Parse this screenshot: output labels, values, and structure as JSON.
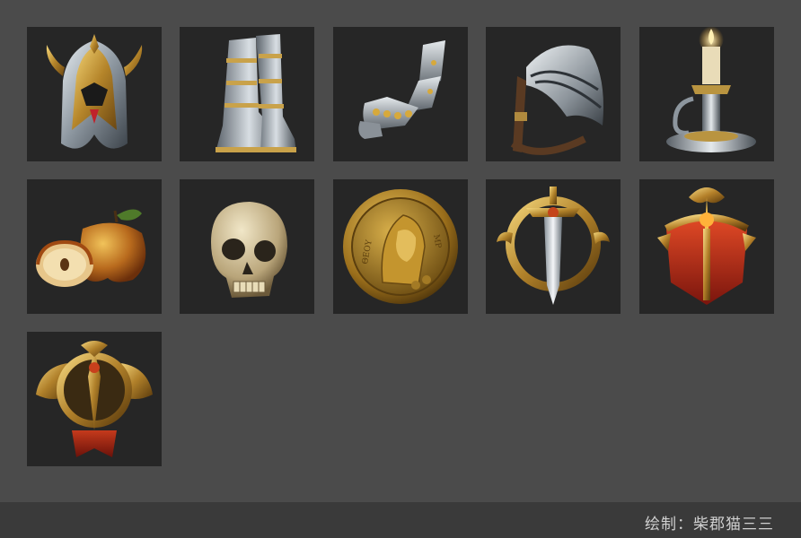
{
  "footer": {
    "credit": "绘制：柴郡猫三三"
  },
  "icons": [
    {
      "name": "golden-helmet-icon"
    },
    {
      "name": "armored-boots-icon"
    },
    {
      "name": "gauntlet-icon"
    },
    {
      "name": "pauldron-icon"
    },
    {
      "name": "candle-holder-icon"
    },
    {
      "name": "apple-icon"
    },
    {
      "name": "skull-icon"
    },
    {
      "name": "madonna-coin-icon"
    },
    {
      "name": "sword-emblem-icon"
    },
    {
      "name": "red-crest-emblem-icon"
    },
    {
      "name": "winged-crest-emblem-icon"
    }
  ],
  "coin": {
    "text_left": "ΘΕΟΥ",
    "text_right": "ΜΡ"
  }
}
